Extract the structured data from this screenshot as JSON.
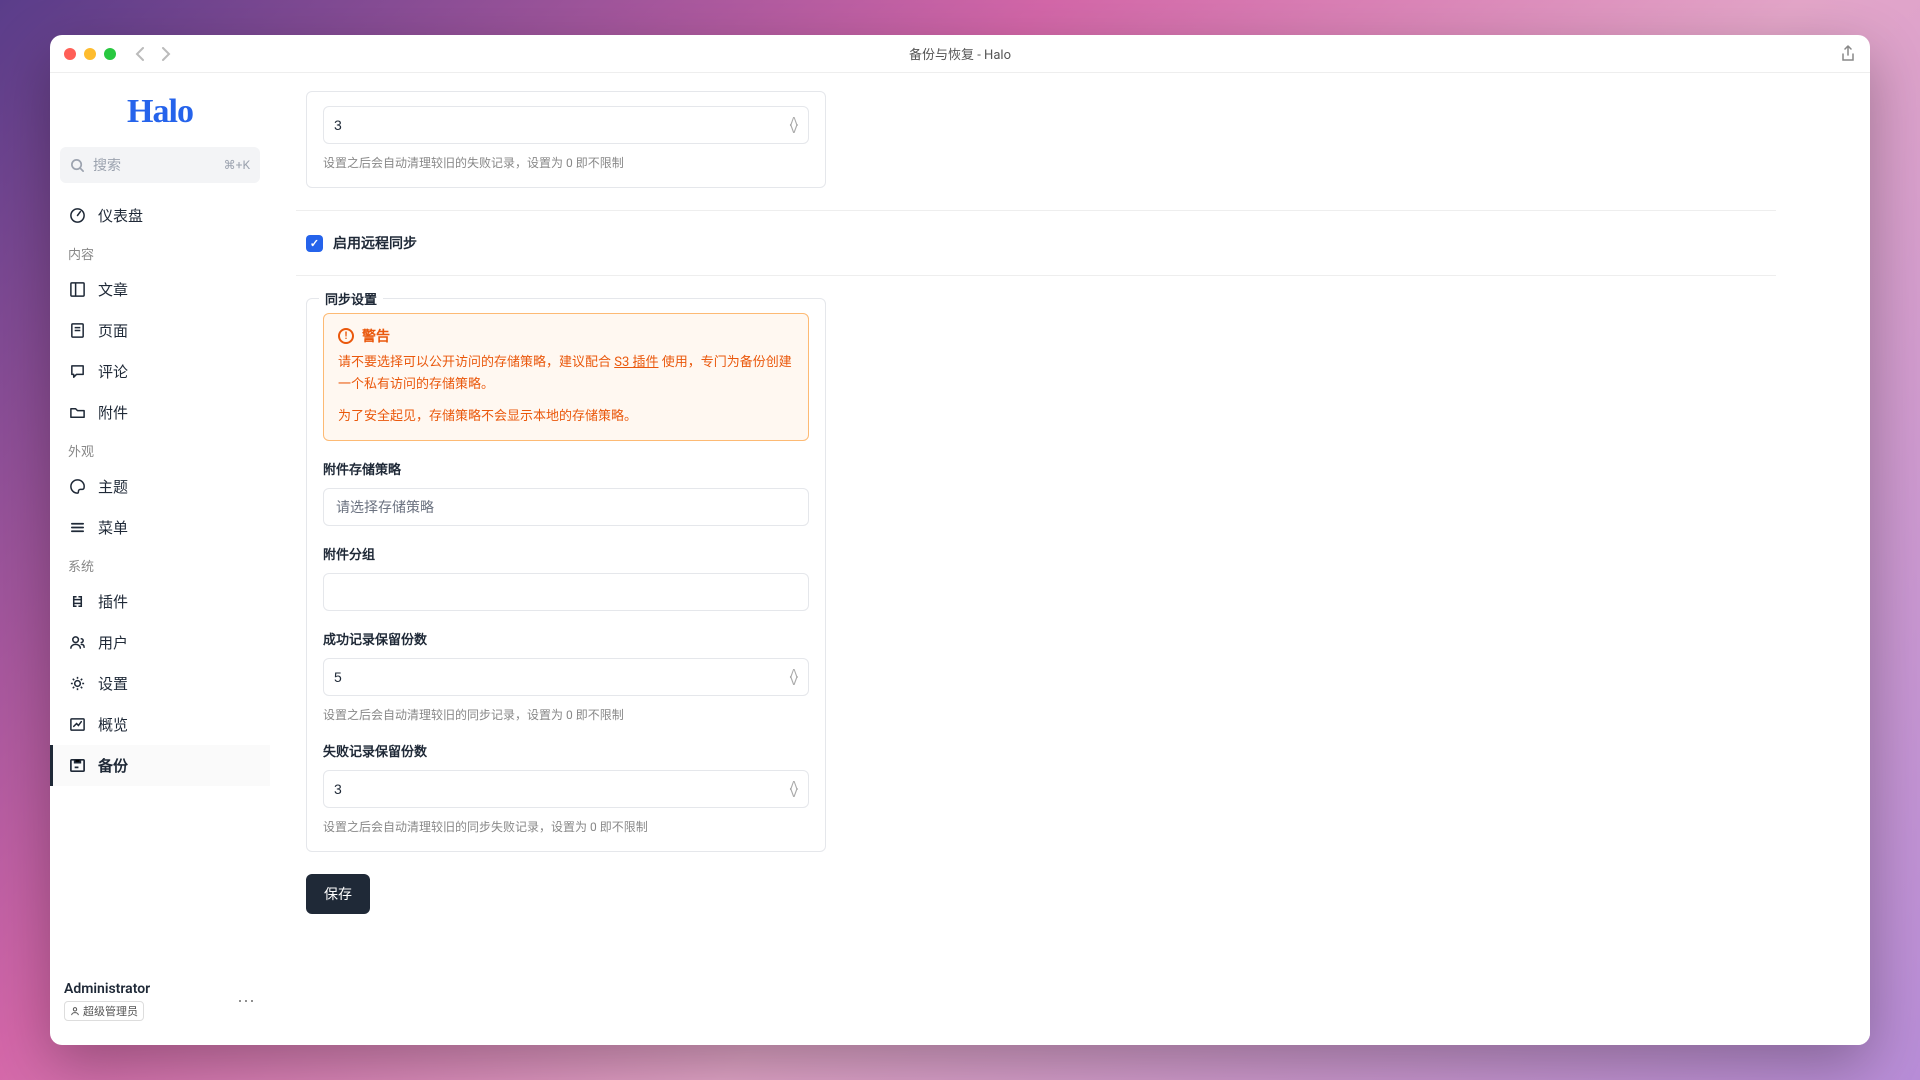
{
  "window": {
    "title": "备份与恢复 - Halo"
  },
  "logo": "Halo",
  "search": {
    "placeholder": "搜索",
    "shortcut": "⌘+K"
  },
  "sidebar": {
    "dashboard": "仪表盘",
    "groups": {
      "content": "内容",
      "appearance": "外观",
      "system": "系统"
    },
    "items": {
      "posts": "文章",
      "pages": "页面",
      "comments": "评论",
      "attachments": "附件",
      "themes": "主题",
      "menus": "菜单",
      "plugins": "插件",
      "users": "用户",
      "settings": "设置",
      "overview": "概览",
      "backup": "备份"
    }
  },
  "user": {
    "name": "Administrator",
    "role": "超级管理员"
  },
  "top_field": {
    "value": "3",
    "hint": "设置之后会自动清理较旧的失败记录，设置为 0 即不限制"
  },
  "enable_remote_sync": "启用远程同步",
  "sync_settings": {
    "legend": "同步设置",
    "alert": {
      "title": "警告",
      "line1_a": "请不要选择可以公开访问的存储策略，建议配合 ",
      "link": "S3 插件",
      "line1_b": " 使用，专门为备份创建一个私有访问的存储策略。",
      "line2": "为了安全起见，存储策略不会显示本地的存储策略。"
    },
    "storage": {
      "label": "附件存储策略",
      "placeholder": "请选择存储策略"
    },
    "group": {
      "label": "附件分组",
      "value": ""
    },
    "success_retain": {
      "label": "成功记录保留份数",
      "value": "5",
      "hint": "设置之后会自动清理较旧的同步记录，设置为 0 即不限制"
    },
    "fail_retain": {
      "label": "失败记录保留份数",
      "value": "3",
      "hint": "设置之后会自动清理较旧的同步失败记录，设置为 0 即不限制"
    }
  },
  "save_button": "保存"
}
